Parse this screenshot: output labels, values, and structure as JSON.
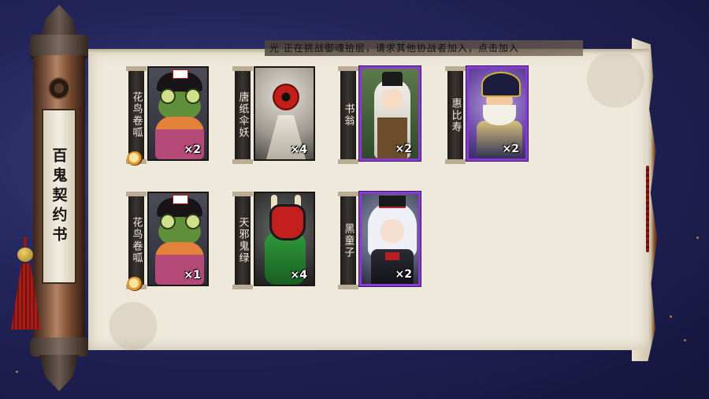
{
  "banner": {
    "prefix": "光",
    "text": "正在挑战御魂拾层，请求其他协战者加入，点击加入"
  },
  "book_title": "百鬼契约书",
  "cards": [
    {
      "name": "花鸟卷呱",
      "count": "×2",
      "rarity": "R",
      "art": "frog",
      "badge": true
    },
    {
      "name": "唐纸伞妖",
      "count": "×4",
      "rarity": "N",
      "art": "umbrella",
      "badge": false
    },
    {
      "name": "书翁",
      "count": "×2",
      "rarity": "SR",
      "art": "shuweng",
      "badge": false
    },
    {
      "name": "惠比寿",
      "count": "×2",
      "rarity": "SR",
      "art": "ebisu",
      "badge": false
    },
    {
      "name": "花鸟卷呱",
      "count": "×1",
      "rarity": "R",
      "art": "frog",
      "badge": true
    },
    {
      "name": "天邪鬼绿",
      "count": "×4",
      "rarity": "N",
      "art": "tenja",
      "badge": false
    },
    {
      "name": "黑童子",
      "count": "×2",
      "rarity": "SR",
      "art": "kurodouji",
      "badge": false
    }
  ],
  "colors": {
    "sr_border": "#8a3ad4",
    "paper": "#efe9dc",
    "background": "#23245a"
  },
  "icons": {
    "badge": "talisman-icon",
    "tassel": "tassel-icon",
    "emblem": "tomoe-emblem-icon"
  }
}
